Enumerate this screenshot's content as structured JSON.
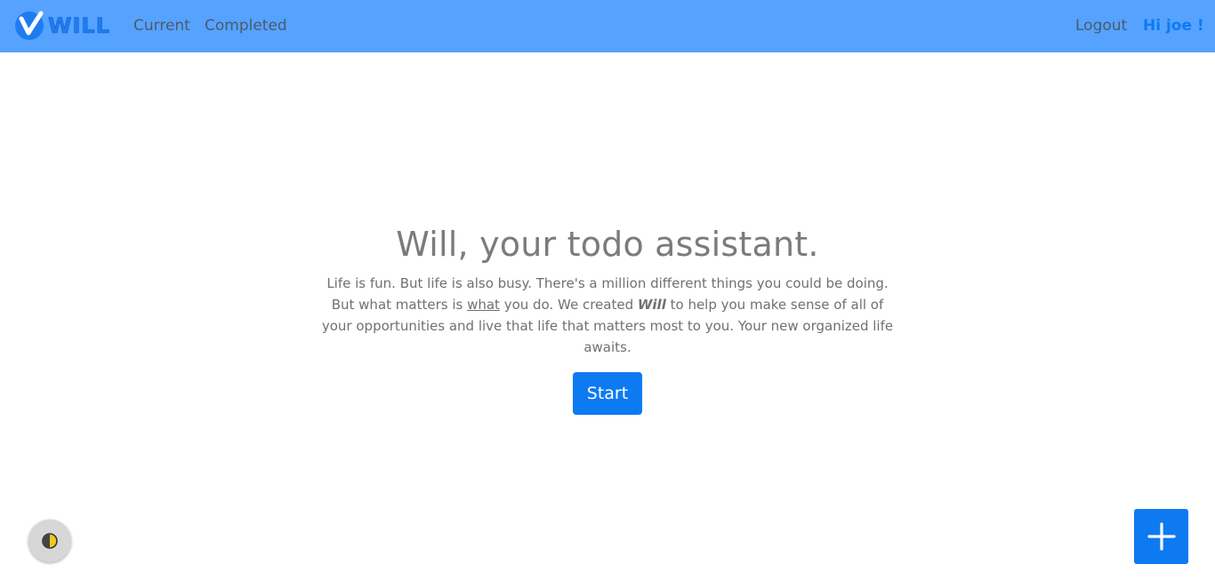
{
  "header": {
    "logo": {
      "wordmark": "WILL",
      "icon": "checkmark-logo-icon"
    },
    "nav": {
      "current_label": "Current",
      "completed_label": "Completed",
      "logout_label": "Logout",
      "greeting": "Hi joe !"
    }
  },
  "hero": {
    "title": "Will, your todo assistant.",
    "text": {
      "p1": "Life is fun. But life is also busy. There's a million different things you could be doing. But what matters is ",
      "underlined": "what",
      "p2": " you do. We created ",
      "emphasis": "Will",
      "p3": " to help you make sense of all of your opportunities and live that life that matters most to you. Your new organized life awaits."
    },
    "start_label": "Start"
  },
  "floating": {
    "theme_toggle_icon": "half-moon-icon",
    "add_icon": "plus-icon"
  },
  "colors": {
    "navbar": "#55a3ff",
    "accent": "#0d7af2",
    "heading": "#7b7b7b",
    "body_text": "#707070"
  }
}
